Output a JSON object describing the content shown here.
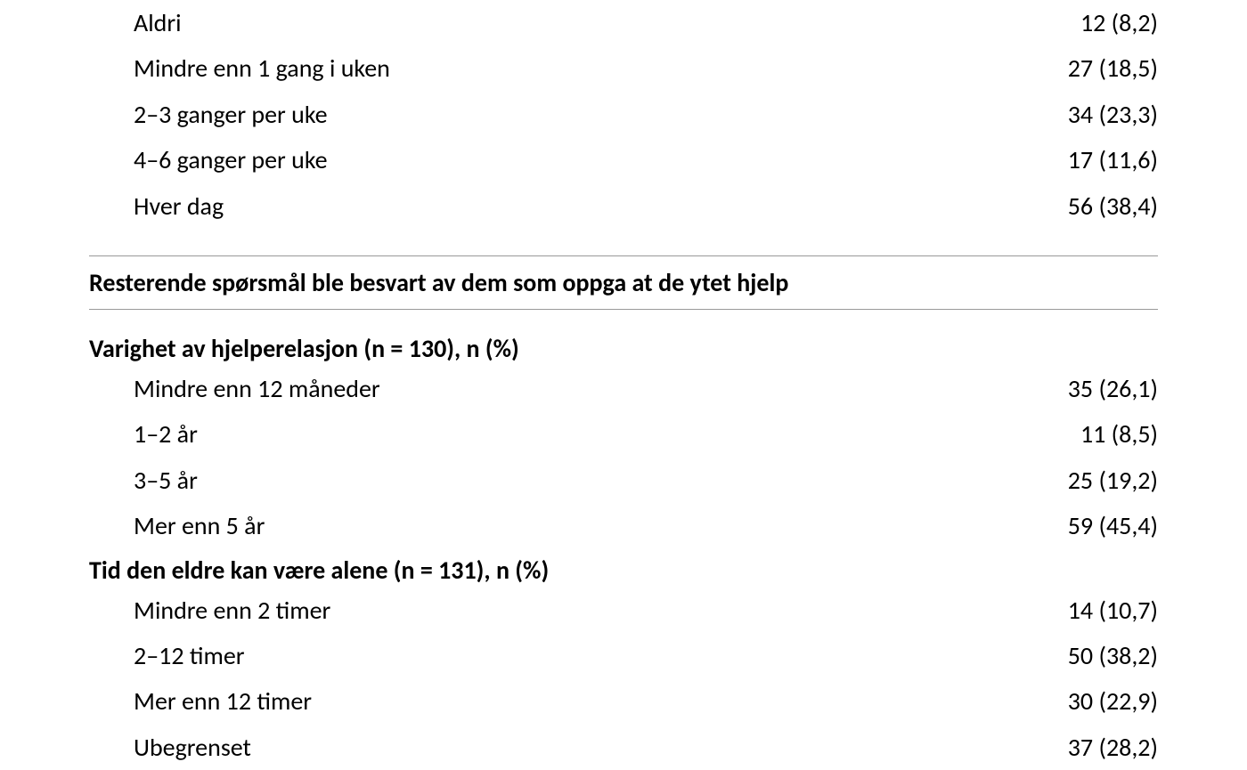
{
  "top_section": {
    "rows": [
      {
        "label": "Aldri",
        "value": "12 (8,2)"
      },
      {
        "label": "Mindre enn 1 gang i uken",
        "value": "27 (18,5)"
      },
      {
        "label": "2–3 ganger per uke",
        "value": "34 (23,3)"
      },
      {
        "label": "4–6 ganger per uke",
        "value": "17 (11,6)"
      },
      {
        "label": "Hver dag",
        "value": "56 (38,4)"
      }
    ]
  },
  "section_header": "Resterende spørsmål ble besvart av dem som oppga at de ytet hjelp",
  "group1": {
    "header": "Varighet av hjelperelasjon (n = 130), n (%)",
    "rows": [
      {
        "label": "Mindre enn 12 måneder",
        "value": "35 (26,1)"
      },
      {
        "label": "1–2 år",
        "value": "11 (8,5)"
      },
      {
        "label": "3–5 år",
        "value": "25 (19,2)"
      },
      {
        "label": "Mer enn 5 år",
        "value": "59 (45,4)"
      }
    ]
  },
  "group2": {
    "header": "Tid den eldre kan være alene (n = 131), n (%)",
    "rows": [
      {
        "label": "Mindre enn 2 timer",
        "value": "14 (10,7)"
      },
      {
        "label": "2–12 timer",
        "value": "50 (38,2)"
      },
      {
        "label": "Mer enn 12 timer",
        "value": "30 (22,9)"
      },
      {
        "label": "Ubegrenset",
        "value": "37 (28,2)"
      }
    ]
  }
}
